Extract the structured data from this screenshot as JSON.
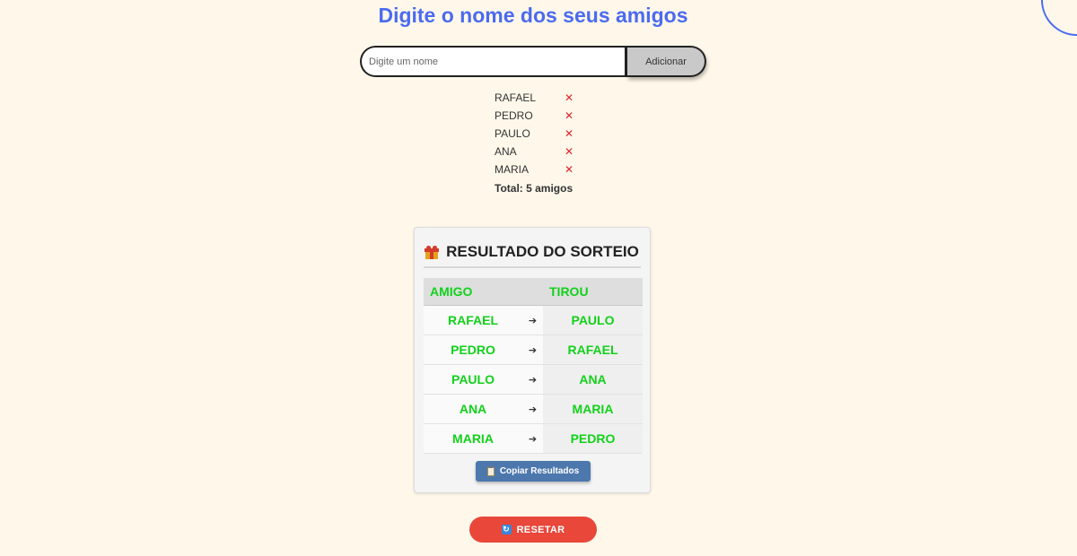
{
  "header": {
    "title": "Digite o nome dos seus amigos"
  },
  "form": {
    "input_value": "",
    "input_placeholder": "Digite um nome",
    "add_label": "Adicionar"
  },
  "friends": {
    "items": [
      {
        "name": "RAFAEL",
        "remove_icon": "✕"
      },
      {
        "name": "PEDRO",
        "remove_icon": "✕"
      },
      {
        "name": "PAULO",
        "remove_icon": "✕"
      },
      {
        "name": "ANA",
        "remove_icon": "✕"
      },
      {
        "name": "MARIA",
        "remove_icon": "✕"
      }
    ],
    "total_label": "Total: 5 amigos"
  },
  "result": {
    "title": "RESULTADO DO SORTEIO",
    "title_icon": "gift-icon",
    "columns": [
      "AMIGO",
      "TIROU"
    ],
    "arrow": "➔",
    "rows": [
      {
        "giver": "RAFAEL",
        "receiver": "PAULO"
      },
      {
        "giver": "PEDRO",
        "receiver": "RAFAEL"
      },
      {
        "giver": "PAULO",
        "receiver": "ANA"
      },
      {
        "giver": "ANA",
        "receiver": "MARIA"
      },
      {
        "giver": "MARIA",
        "receiver": "PEDRO"
      }
    ],
    "copy_label": "Copiar Resultados",
    "copy_icon": "clipboard-icon"
  },
  "reset": {
    "label": "RESETAR",
    "icon": "refresh-icon",
    "icon_glyph": "↻"
  },
  "colors": {
    "background": "#fff8ea",
    "title": "#4b6bef",
    "result_text": "#12d11a",
    "remove": "#e0242c",
    "copy_button": "#4d78ad",
    "reset_button": "#e8473a"
  }
}
